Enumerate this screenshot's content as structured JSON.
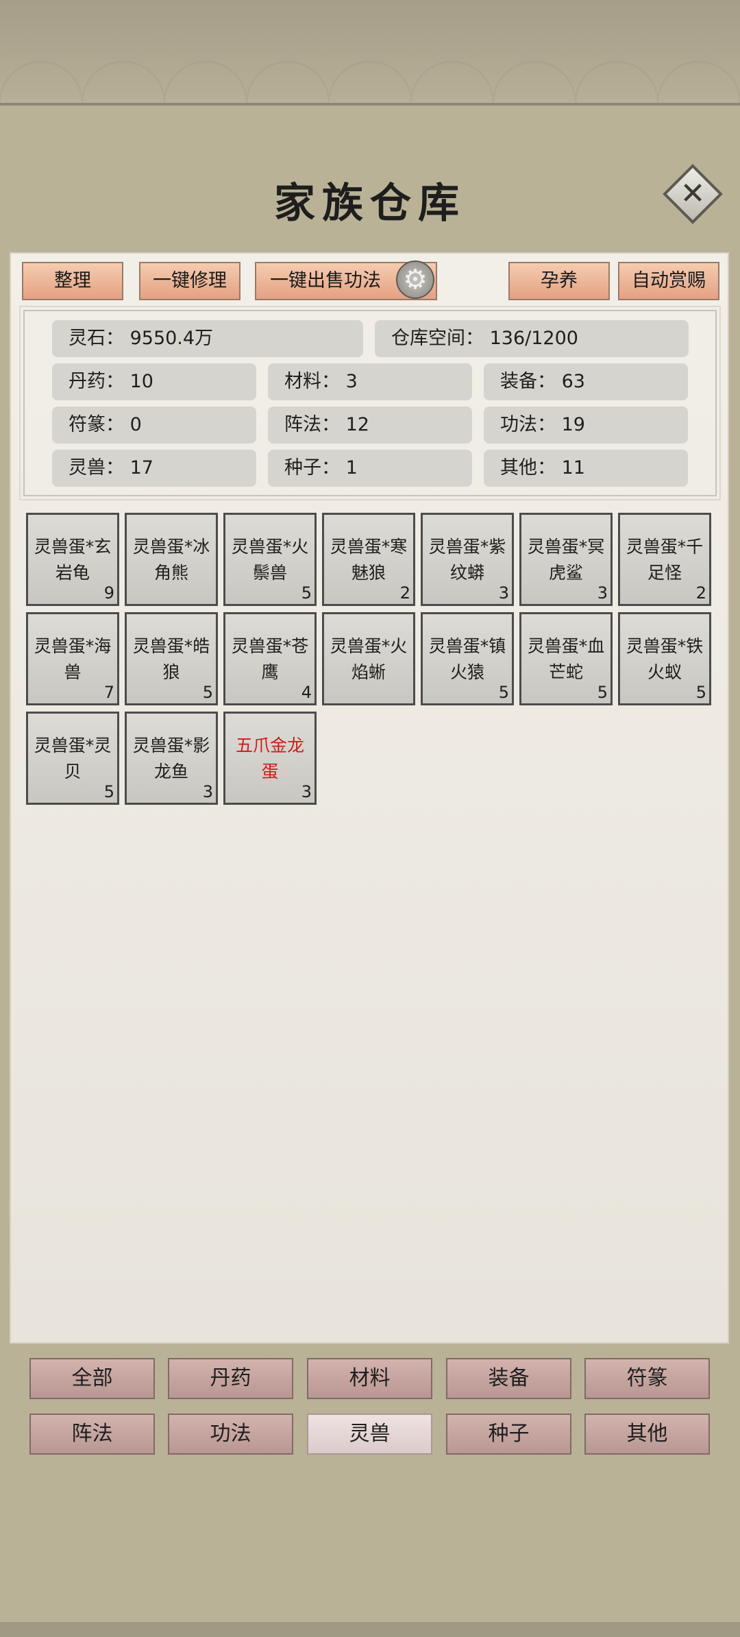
{
  "title": "家族仓库",
  "close_icon": "close-icon",
  "toolbar": {
    "sort": "整理",
    "repair_all": "一键修理",
    "sell_skills": "一键出售功法",
    "gear_icon": "gear-icon",
    "breed": "孕养",
    "auto_reward": "自动赏赐"
  },
  "stats": {
    "spirit_stone": "灵石：  9550.4万",
    "storage": "仓库空间：    136/1200",
    "pills": "丹药：  10",
    "materials": "材料：  3",
    "equipment": "装备：  63",
    "talismans": "符篆：  0",
    "formations": "阵法：  12",
    "skills": "功法：  19",
    "beasts": "灵兽：  17",
    "seeds": "种子：  1",
    "others": "其他：  11"
  },
  "items": [
    {
      "line1": "灵兽蛋*玄",
      "line2": "岩龟",
      "count": "9"
    },
    {
      "line1": "灵兽蛋*冰",
      "line2": "角熊",
      "count": ""
    },
    {
      "line1": "灵兽蛋*火",
      "line2": "鬃兽",
      "count": "5"
    },
    {
      "line1": "灵兽蛋*寒",
      "line2": "魅狼",
      "count": "2"
    },
    {
      "line1": "灵兽蛋*紫",
      "line2": "纹蟒",
      "count": "3"
    },
    {
      "line1": "灵兽蛋*冥",
      "line2": "虎鲨",
      "count": "3"
    },
    {
      "line1": "灵兽蛋*千",
      "line2": "足怪",
      "count": "2"
    },
    {
      "line1": "灵兽蛋*海",
      "line2": "兽",
      "count": "7"
    },
    {
      "line1": "灵兽蛋*皓",
      "line2": "狼",
      "count": "5"
    },
    {
      "line1": "灵兽蛋*苍",
      "line2": "鹰",
      "count": "4"
    },
    {
      "line1": "灵兽蛋*火",
      "line2": "焰蜥",
      "count": ""
    },
    {
      "line1": "灵兽蛋*镇",
      "line2": "火猿",
      "count": "5"
    },
    {
      "line1": "灵兽蛋*血",
      "line2": "芒蛇",
      "count": "5"
    },
    {
      "line1": "灵兽蛋*铁",
      "line2": "火蚁",
      "count": "5"
    },
    {
      "line1": "灵兽蛋*灵",
      "line2": "贝",
      "count": "5"
    },
    {
      "line1": "灵兽蛋*影",
      "line2": "龙鱼",
      "count": "3"
    },
    {
      "line1": "五爪金龙",
      "line2": "蛋",
      "count": "3",
      "rare": true
    }
  ],
  "rare_color": "#d01a1a",
  "tabs": [
    "全部",
    "丹药",
    "材料",
    "装备",
    "符篆",
    "阵法",
    "功法",
    "灵兽",
    "种子",
    "其他"
  ],
  "active_tab": "灵兽"
}
